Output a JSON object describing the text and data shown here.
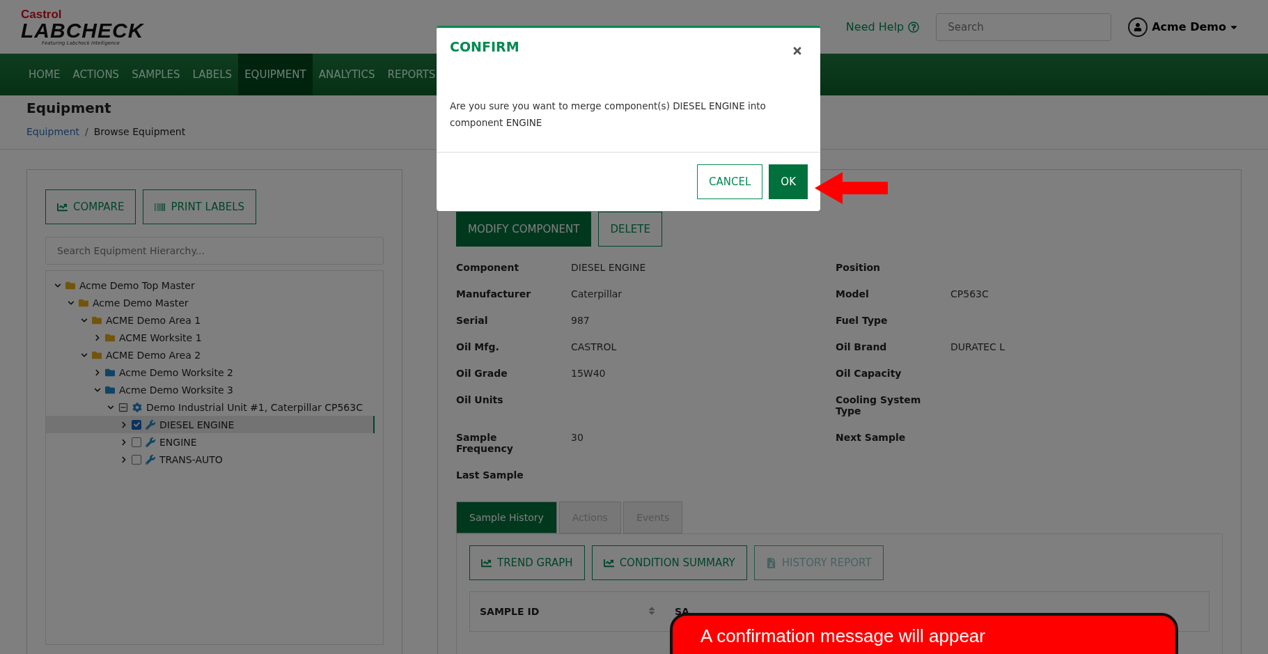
{
  "logo": {
    "brand": "Castrol",
    "product": "LABCHECK",
    "tagline": "Featuring Labcheck Intelligence"
  },
  "header": {
    "help": "Need Help",
    "search_placeholder": "Search",
    "user": "Acme Demo"
  },
  "nav": [
    {
      "label": "HOME",
      "selected": false
    },
    {
      "label": "ACTIONS",
      "selected": false
    },
    {
      "label": "SAMPLES",
      "selected": false
    },
    {
      "label": "LABELS",
      "selected": false
    },
    {
      "label": "EQUIPMENT",
      "selected": true
    },
    {
      "label": "ANALYTICS",
      "selected": false
    },
    {
      "label": "REPORTS",
      "selected": false
    }
  ],
  "page": {
    "title": "Equipment",
    "breadcrumb_separator": "/",
    "breadcrumb": [
      {
        "label": "Equipment",
        "kind": "link"
      },
      {
        "label": "Browse Equipment",
        "kind": "current"
      }
    ]
  },
  "left_panel": {
    "buttons": [
      {
        "label": "COMPARE",
        "kind": "chart"
      },
      {
        "label": "PRINT LABELS",
        "kind": "barcode"
      }
    ],
    "search_placeholder": "Search Equipment Hierarchy...",
    "tree": [
      {
        "label": "Acme Demo Top Master",
        "kind": "folder",
        "color": "#73540c",
        "expanded": true,
        "children": [
          {
            "label": "Acme Demo Master",
            "kind": "folder",
            "color": "#73540c",
            "expanded": true,
            "children": [
              {
                "label": "ACME Demo Area 1",
                "kind": "folder",
                "color": "#73540c",
                "expanded": true,
                "children": [
                  {
                    "label": "ACME Worksite 1",
                    "kind": "folder",
                    "color": "#73540c",
                    "expanded": false
                  }
                ]
              },
              {
                "label": "ACME Demo Area 2",
                "kind": "folder",
                "color": "#73540c",
                "expanded": true,
                "children": [
                  {
                    "label": "Acme Demo Worksite 2",
                    "kind": "folder",
                    "color": "#0f4464",
                    "expanded": false
                  },
                  {
                    "label": "Acme Demo Worksite 3",
                    "kind": "folder",
                    "color": "#0f4464",
                    "expanded": true,
                    "children": [
                      {
                        "label": "Demo Industrial Unit #1, Caterpillar CP563C",
                        "kind": "unit",
                        "expanded": true,
                        "children": [
                          {
                            "label": "DIESEL ENGINE",
                            "kind": "component",
                            "expanded": false,
                            "checked": true,
                            "selected": true
                          },
                          {
                            "label": "ENGINE",
                            "kind": "component",
                            "expanded": false,
                            "checked": false,
                            "selected": false
                          },
                          {
                            "label": "TRANS-AUTO",
                            "kind": "component",
                            "expanded": false,
                            "checked": false,
                            "selected": false
                          }
                        ]
                      }
                    ]
                  }
                ]
              }
            ]
          }
        ]
      }
    ]
  },
  "detail": {
    "buttons": [
      {
        "label": "MODIFY COMPONENT",
        "kind": "primary"
      },
      {
        "label": "DELETE",
        "kind": "outline"
      }
    ],
    "fields": [
      {
        "label": "Component",
        "value": "DIESEL ENGINE"
      },
      {
        "label": "Position"
      },
      {
        "label": "Manufacturer",
        "value": "Caterpillar"
      },
      {
        "label": "Model",
        "value": "CP563C"
      },
      {
        "label": "Serial",
        "value": "987"
      },
      {
        "label": "Fuel Type"
      },
      {
        "label": "Oil Mfg.",
        "value": "CASTROL"
      },
      {
        "label": "Oil Brand",
        "value": "DURATEC L"
      },
      {
        "label": "Oil Grade",
        "value": "15W40"
      },
      {
        "label": "Oil Capacity"
      },
      {
        "label": "Oil Units"
      },
      {
        "label": "Cooling System Type"
      },
      {
        "label": "Sample Frequency",
        "value": "30"
      },
      {
        "label": "Next Sample"
      },
      {
        "label": "Last Sample"
      }
    ],
    "tabs": [
      {
        "label": "Sample History",
        "selected": true
      },
      {
        "label": "Actions",
        "selected": false
      },
      {
        "label": "Events",
        "selected": false
      }
    ],
    "tab_buttons": [
      {
        "label": "TREND GRAPH",
        "kind": "chart",
        "disabled": false
      },
      {
        "label": "CONDITION SUMMARY",
        "kind": "chart",
        "disabled": false
      },
      {
        "label": "HISTORY REPORT",
        "kind": "excel",
        "disabled": true
      }
    ],
    "table": {
      "columns": [
        "SAMPLE ID",
        "SA"
      ]
    }
  },
  "dialog": {
    "title": "CONFIRM",
    "message": "Are you sure you want to merge component(s) DIESEL ENGINE into component ENGINE",
    "buttons": [
      {
        "label": "CANCEL",
        "kind": "outline"
      },
      {
        "label": "OK",
        "kind": "primary"
      }
    ]
  },
  "callout": {
    "text": "A confirmation message will appear"
  }
}
